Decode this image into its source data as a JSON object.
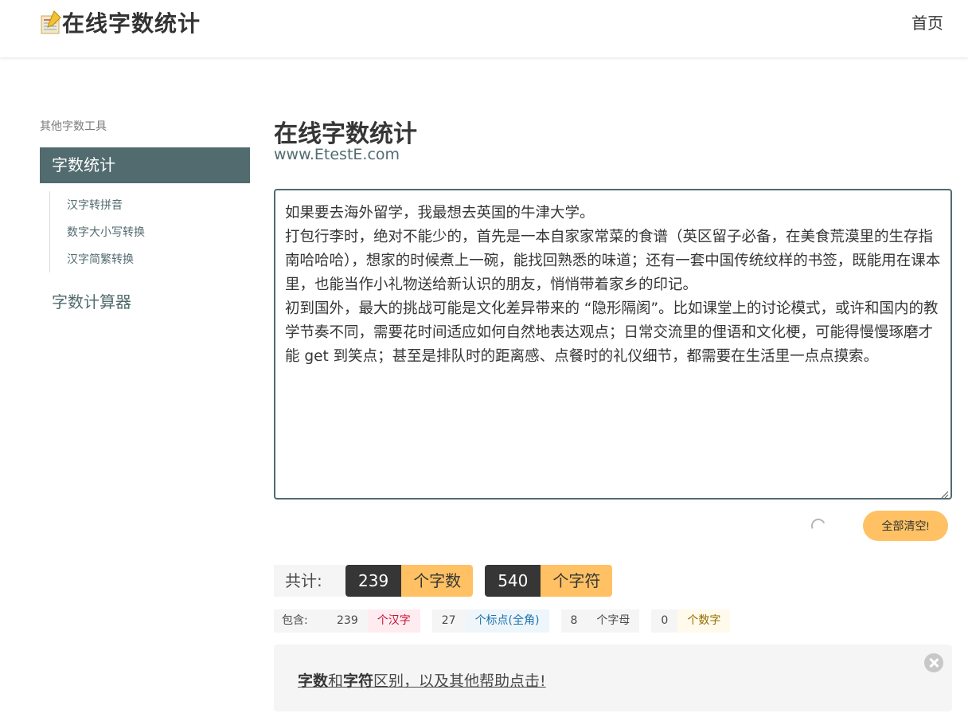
{
  "navbar": {
    "brand": "在线字数统计",
    "home": "首页"
  },
  "sidebar": {
    "label": "其他字数工具",
    "active": "字数统计",
    "items": [
      {
        "label": "汉字转拼音"
      },
      {
        "label": "数字大小写转换"
      },
      {
        "label": "汉字简繁转换"
      }
    ],
    "calculator": "字数计算器"
  },
  "main": {
    "title": "在线字数统计",
    "subtitle": "www.EtestE.com",
    "text": "如果要去海外留学，我最想去英国的牛津大学。\n打包行李时，绝对不能少的，首先是一本自家家常菜的食谱（英区留子必备，在美食荒漠里的生存指南哈哈哈），想家的时候煮上一碗，能找回熟悉的味道；还有一套中国传统纹样的书签，既能用在课本里，也能当作小礼物送给新认识的朋友，悄悄带着家乡的印记。\n初到国外，最大的挑战可能是文化差异带来的 “隐形隔阂”。比如课堂上的讨论模式，或许和国内的教学节奏不同，需要花时间适应如何自然地表达观点；日常交流里的俚语和文化梗，可能得慢慢琢磨才能 get 到笑点；甚至是排队时的距离感、点餐时的礼仪细节，都需要在生活里一点点摸索。",
    "clear_button": "全部清空!"
  },
  "totals": {
    "label": "共计:",
    "words": "239",
    "words_unit": "个字数",
    "chars": "540",
    "chars_unit": "个字符"
  },
  "details": {
    "label": "包含:",
    "hanzi_count": "239",
    "hanzi_unit": "个汉字",
    "punct_count": "27",
    "punct_unit": "个标点(全角)",
    "letter_count": "8",
    "letter_unit": "个字母",
    "digit_count": "0",
    "digit_unit": "个数字"
  },
  "notice": {
    "part1": "字数",
    "part2": "和",
    "part3": "字符",
    "part4": "区别，以及其他帮助点击!"
  }
}
